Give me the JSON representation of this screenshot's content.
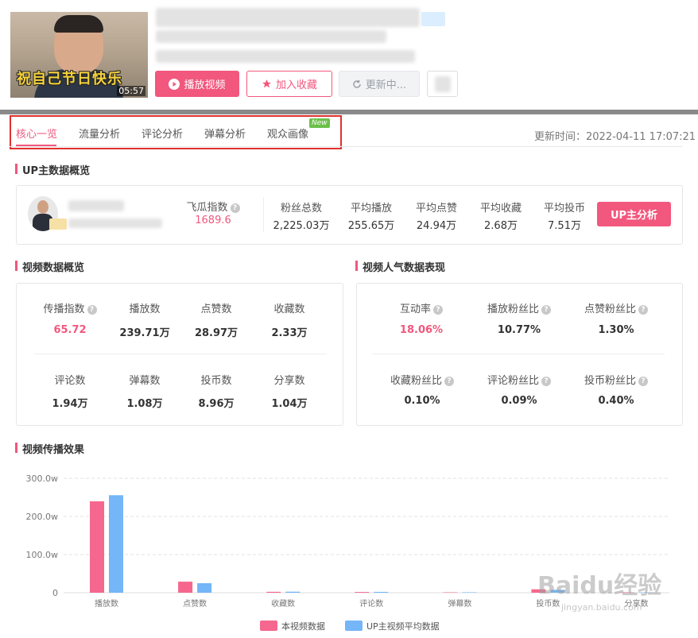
{
  "video": {
    "duration": "05:57",
    "thumbnail_caption": "祝自己节日快乐"
  },
  "actions": {
    "play_label": "播放视频",
    "favorite_label": "加入收藏",
    "update_label": "更新中..."
  },
  "tabs": [
    {
      "label": "核心一览",
      "active": true
    },
    {
      "label": "流量分析"
    },
    {
      "label": "评论分析"
    },
    {
      "label": "弹幕分析"
    },
    {
      "label": "观众画像",
      "badge": "New"
    }
  ],
  "update_time": "更新时间：2022-04-11 17:07:21",
  "up_overview": {
    "title": "UP主数据概览",
    "index_label": "飞瓜指数",
    "index_value": "1689.6",
    "stats": [
      {
        "label": "粉丝总数",
        "value": "2,225.03万"
      },
      {
        "label": "平均播放",
        "value": "255.65万"
      },
      {
        "label": "平均点赞",
        "value": "24.94万"
      },
      {
        "label": "平均收藏",
        "value": "2.68万"
      },
      {
        "label": "平均投币",
        "value": "7.51万"
      }
    ],
    "analysis_button": "UP主分析"
  },
  "video_overview": {
    "title": "视频数据概览",
    "row1": [
      {
        "label": "传播指数",
        "value": "65.72",
        "help": true,
        "highlight": true
      },
      {
        "label": "播放数",
        "value": "239.71万"
      },
      {
        "label": "点赞数",
        "value": "28.97万"
      },
      {
        "label": "收藏数",
        "value": "2.33万"
      }
    ],
    "row2": [
      {
        "label": "评论数",
        "value": "1.94万"
      },
      {
        "label": "弹幕数",
        "value": "1.08万"
      },
      {
        "label": "投币数",
        "value": "8.96万"
      },
      {
        "label": "分享数",
        "value": "1.04万"
      }
    ]
  },
  "popularity": {
    "title": "视频人气数据表现",
    "row1": [
      {
        "label": "互动率",
        "value": "18.06%",
        "highlight": true
      },
      {
        "label": "播放粉丝比",
        "value": "10.77%"
      },
      {
        "label": "点赞粉丝比",
        "value": "1.30%"
      }
    ],
    "row2": [
      {
        "label": "收藏粉丝比",
        "value": "0.10%"
      },
      {
        "label": "评论粉丝比",
        "value": "0.09%"
      },
      {
        "label": "投币粉丝比",
        "value": "0.40%"
      }
    ]
  },
  "spread": {
    "title": "视频传播效果"
  },
  "chart_data": {
    "type": "bar",
    "categories": [
      "播放数",
      "点赞数",
      "收藏数",
      "评论数",
      "弹幕数",
      "投币数",
      "分享数"
    ],
    "series": [
      {
        "name": "本视频数据",
        "color": "#f5678e",
        "values": [
          239.71,
          28.97,
          2.33,
          1.94,
          1.08,
          8.96,
          1.04
        ]
      },
      {
        "name": "UP主视频平均数据",
        "color": "#74b6f7",
        "values": [
          255.65,
          24.94,
          2.68,
          2.2,
          1.2,
          7.51,
          1.1
        ]
      }
    ],
    "yticks": [
      "0",
      "100.0w",
      "200.0w",
      "300.0w"
    ],
    "ylim": [
      0,
      300
    ],
    "legend_position": "bottom",
    "grid": true
  },
  "watermark": {
    "text": "Baidu经验",
    "url": "jingyan.baidu.com"
  }
}
